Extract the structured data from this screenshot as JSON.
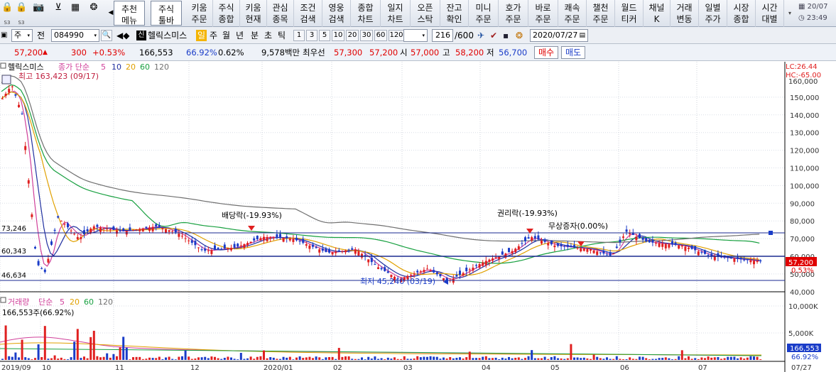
{
  "toolbar": {
    "icon_labels": [
      "S3",
      "S3"
    ],
    "buttons": [
      {
        "label": "추천\n메뉴"
      },
      {
        "label": "주식\n툴바"
      },
      {
        "label": "키움\n주문"
      },
      {
        "label": "주식\n종합"
      },
      {
        "label": "키움\n현재"
      },
      {
        "label": "관심\n종목"
      },
      {
        "label": "조건\n검색"
      },
      {
        "label": "영웅\n검색"
      },
      {
        "label": "종합\n차트"
      },
      {
        "label": "일지\n차트"
      },
      {
        "label": "오픈\n스탁"
      },
      {
        "label": "잔고\n확인"
      },
      {
        "label": "미니\n주문"
      },
      {
        "label": "호가\n주문"
      },
      {
        "label": "바로\n주문"
      },
      {
        "label": "쾌속\n주문"
      },
      {
        "label": "챌천\n주문"
      },
      {
        "label": "월드\n티커"
      },
      {
        "label": "채널\nK"
      },
      {
        "label": "거래\n변동"
      },
      {
        "label": "일별\n주가"
      },
      {
        "label": "시장\n종합"
      },
      {
        "label": "시간\n대별"
      }
    ],
    "clock_date": "20/07",
    "clock_time": "23:49"
  },
  "controls": {
    "market": "주",
    "market_label": "전",
    "code": "084990",
    "name_badge": "신",
    "stock_name": "헬릭스미스",
    "period_tabs": [
      "일",
      "주",
      "월",
      "년",
      "분",
      "초",
      "틱"
    ],
    "minute_values": [
      "1",
      "3",
      "5",
      "10",
      "20",
      "30",
      "60",
      "120"
    ],
    "count": "216",
    "count_total": "/600",
    "date": "2020/07/27"
  },
  "quote": {
    "price": "57,200",
    "change": "300",
    "change_pct": "+0.53%",
    "volume": "166,553",
    "vol_ratio": "66.92%",
    "turnover_pct": "0.62%",
    "amount": "9,578백만",
    "best_ask_label": "최우선",
    "ask": "57,300",
    "bid": "57,200",
    "open_label": "시",
    "open": "57,000",
    "high_label": "고",
    "high": "58,200",
    "low_label": "저",
    "low": "56,700",
    "buy_button": "매수",
    "sell_button": "매도"
  },
  "price_chart": {
    "legend_name": "헬릭스미스",
    "legend_ma": "종가 단순",
    "ma_periods": [
      "5",
      "10",
      "20",
      "60",
      "120"
    ],
    "ma_colors": [
      "#d0409a",
      "#2030a0",
      "#e0a000",
      "#18a040",
      "#707070"
    ],
    "high_note": "최고 163,423 (09/17)",
    "low_note": "최저 45,240 (03/19)",
    "event1": "배당락(-19.93%)",
    "event2": "권리락(-19.93%)",
    "event3": "무상증자(0.00%)",
    "lc": "LC:26.44",
    "hc": "HC:-65.00",
    "h_lines": [
      "73,246",
      "60,343",
      "46,634"
    ],
    "y_ticks": [
      "150,000",
      "140,000",
      "130,000",
      "120,000",
      "110,000",
      "100,000",
      "90,000",
      "80,000",
      "70,000",
      "60,000",
      "50,000",
      "40,000"
    ],
    "y_tick_values": [
      150000,
      140000,
      130000,
      120000,
      110000,
      100000,
      90000,
      80000,
      70000,
      60000,
      50000,
      40000
    ],
    "price_tag": "57,200",
    "pct_tag": "0.53%",
    "top_tick": "160,000",
    "up_color": "#e02020",
    "down_color": "#1a3cc8"
  },
  "volume_chart": {
    "legend_name": "거래량",
    "legend_ma": "단순",
    "ma_periods": [
      "5",
      "20",
      "60",
      "120"
    ],
    "value_note": "166,553주(66.92%)",
    "y_ticks": [
      "10,000K",
      "5,000K"
    ],
    "y_tick_values": [
      10000,
      5000
    ],
    "vol_tag": "166,553",
    "vol_pct": "66.92%"
  },
  "x_axis": {
    "labels": [
      "2019/09",
      "10",
      "11",
      "12",
      "2020/01",
      "02",
      "03",
      "04",
      "05",
      "06",
      "07"
    ],
    "last_date": "07/27"
  }
}
